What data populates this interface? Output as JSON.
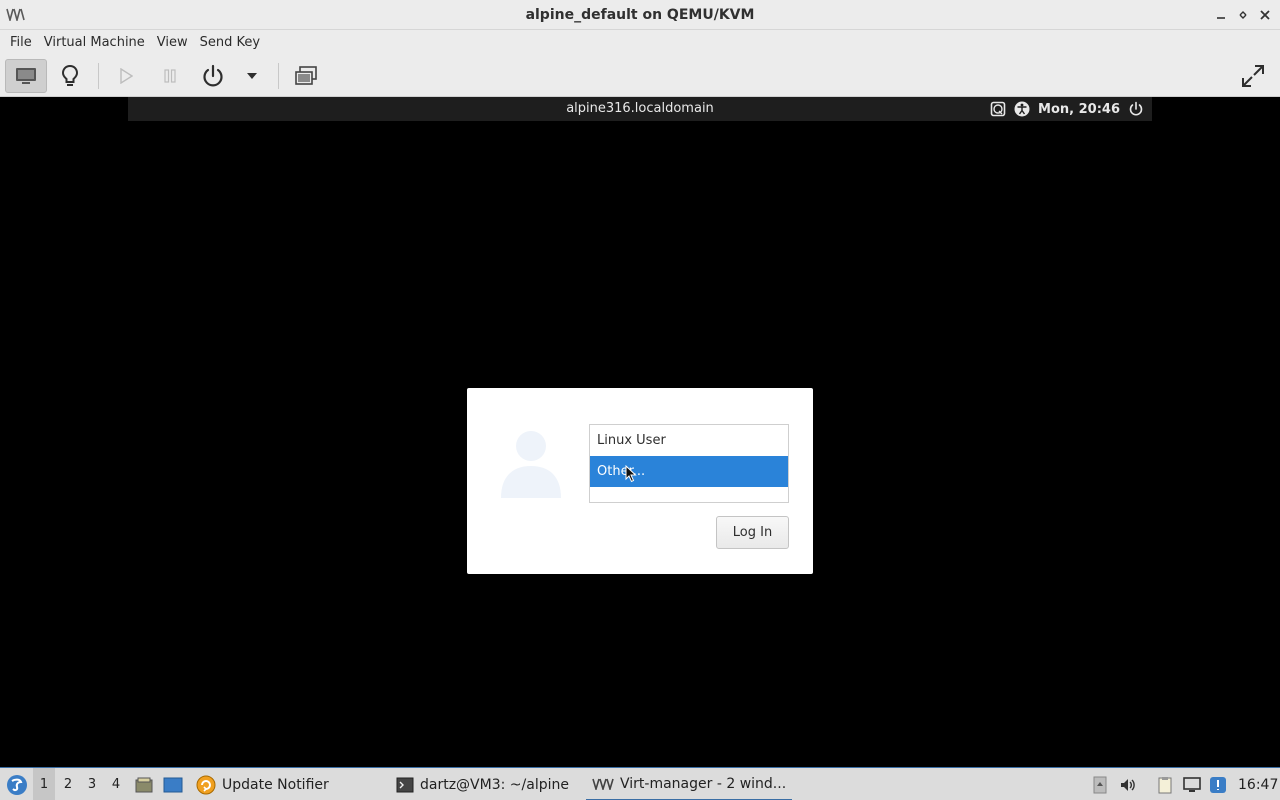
{
  "window": {
    "title": "alpine_default on QEMU/KVM",
    "controls": [
      "minimize-icon",
      "maximize-icon",
      "close-icon"
    ]
  },
  "menubar": {
    "items": [
      "File",
      "Virtual Machine",
      "View",
      "Send Key"
    ]
  },
  "toolbar": {
    "buttons": [
      "console-icon",
      "details-lightbulb-icon",
      "run-icon",
      "pause-icon",
      "power-icon",
      "power-menu-chevron-icon",
      "snapshots-icon",
      "fullscreen-icon"
    ]
  },
  "guest": {
    "topbar": {
      "hostname": "alpine316.localdomain",
      "clock": "Mon, 20:46"
    },
    "login": {
      "users": [
        "Linux User",
        "Other..."
      ],
      "selected_user": "Other...",
      "login_button": "Log In"
    }
  },
  "taskbar": {
    "desktops": [
      "1",
      "2",
      "3",
      "4"
    ],
    "current_desktop": "1",
    "tasks": [
      {
        "label": "Update Notifier",
        "icon": "update-notifier-icon"
      },
      {
        "label": "dartz@VM3: ~/alpine",
        "icon": "terminal-icon"
      },
      {
        "label": "Virt-manager - 2 wind...",
        "icon": "virt-manager-icon",
        "active": true
      }
    ],
    "clock": "16:47"
  },
  "colors": {
    "selection": "#2a83d9",
    "chrome": "#ececec",
    "taskbar": "#dcdcdc",
    "guest_background": "#000000"
  }
}
